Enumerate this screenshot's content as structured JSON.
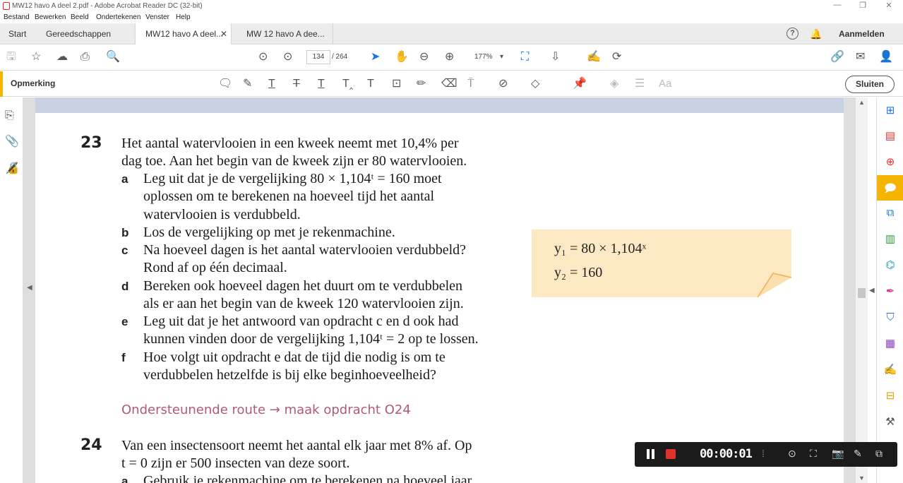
{
  "window": {
    "title": "MW12 havo A deel 2.pdf - Adobe Acrobat Reader DC (32-bit)"
  },
  "menu": [
    "Bestand",
    "Bewerken",
    "Beeld",
    "Ondertekenen",
    "Venster",
    "Help"
  ],
  "tabs": {
    "start": "Start",
    "tools": "Gereedschappen",
    "doc1": "MW12 havo A deel...",
    "doc2": "MW 12 havo A dee..."
  },
  "header": {
    "signin": "Aanmelden"
  },
  "nav": {
    "current_page": "134",
    "total_pages": "/ 264",
    "zoom": "177%"
  },
  "commentbar": {
    "label": "Opmerking",
    "close": "Sluiten"
  },
  "document": {
    "q23": {
      "number": "23",
      "intro1": "Het aantal watervlooien in een kweek neemt met 10,4% per",
      "intro2": "dag toe. Aan het begin van de kweek zijn er 80 watervlooien.",
      "a": {
        "letter": "a",
        "l1": "Leg uit dat je de vergelijking 80 × 1,104ᵗ = 160 moet",
        "l2": "oplossen om te berekenen na hoeveel tijd het aantal",
        "l3": "watervlooien is verdubbeld."
      },
      "b": {
        "letter": "b",
        "l1": "Los de vergelijking op met je rekenmachine."
      },
      "c": {
        "letter": "c",
        "l1": "Na hoeveel dagen is het aantal watervlooien verdubbeld?",
        "l2": "Rond af op één decimaal."
      },
      "d": {
        "letter": "d",
        "l1": "Bereken ook hoeveel dagen het duurt om te verdubbelen",
        "l2": "als er aan het begin van de kweek 120 watervlooien zijn."
      },
      "e": {
        "letter": "e",
        "l1": "Leg uit dat je het antwoord van opdracht c en d ook had",
        "l2": "kunnen vinden door de vergelijking 1,104ᵗ = 2 op te lossen."
      },
      "f": {
        "letter": "f",
        "l1": "Hoe volgt uit opdracht e dat de tijd die nodig is om te",
        "l2": "verdubbelen hetzelfde is bij elke beginhoeveelheid?"
      }
    },
    "support": "Ondersteunende route → maak opdracht O24",
    "q24": {
      "number": "24",
      "intro1": "Van een insectensoort neemt het aantal elk jaar met 8% af. Op",
      "intro2": "t = 0 zijn er 500 insecten van deze soort.",
      "a": {
        "letter": "a",
        "l1": "Gebruik je rekenmachine om te berekenen na hoeveel jaar"
      }
    },
    "calc": {
      "line1": "y₁ = 80 × 1,104ˣ",
      "line2": "y₂ = 160"
    }
  },
  "recorder": {
    "time": "00:00:01"
  },
  "colors": {
    "accent": "#f5b400",
    "support_text": "#b05a78",
    "calc_bg": "#fde8c4",
    "record": "#e0312b"
  }
}
